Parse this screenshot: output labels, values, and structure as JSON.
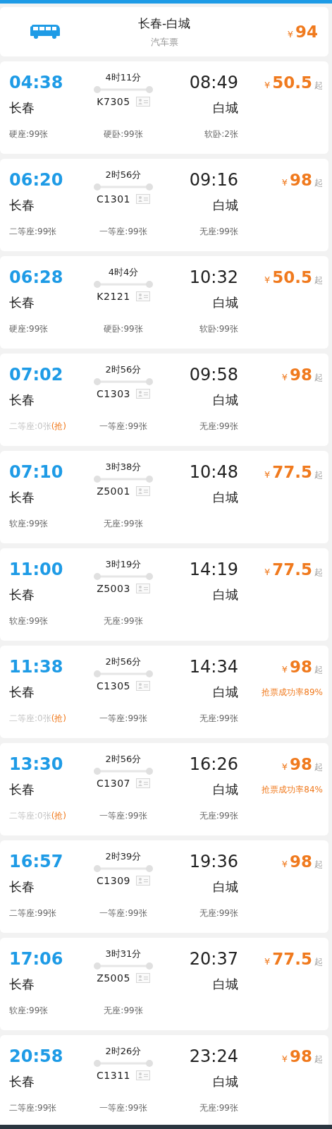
{
  "bus": {
    "title": "长春-白城",
    "subtitle": "汽车票",
    "currency": "¥",
    "price": "94"
  },
  "trains": [
    {
      "depart": "04:38",
      "from": "长春",
      "duration": "4时11分",
      "train": "K7305",
      "arrive": "08:49",
      "to": "白城",
      "currency": "¥",
      "price": "50.5",
      "suffix": "起",
      "seats": [
        {
          "label": "硬座:99张",
          "sold_out": false
        },
        {
          "label": "硬卧:99张",
          "sold_out": false
        },
        {
          "label": "软卧:2张",
          "sold_out": false
        }
      ]
    },
    {
      "depart": "06:20",
      "from": "长春",
      "duration": "2时56分",
      "train": "C1301",
      "arrive": "09:16",
      "to": "白城",
      "currency": "¥",
      "price": "98",
      "suffix": "起",
      "seats": [
        {
          "label": "二等座:99张",
          "sold_out": false
        },
        {
          "label": "一等座:99张",
          "sold_out": false
        },
        {
          "label": "无座:99张",
          "sold_out": false
        }
      ]
    },
    {
      "depart": "06:28",
      "from": "长春",
      "duration": "4时4分",
      "train": "K2121",
      "arrive": "10:32",
      "to": "白城",
      "currency": "¥",
      "price": "50.5",
      "suffix": "起",
      "seats": [
        {
          "label": "硬座:99张",
          "sold_out": false
        },
        {
          "label": "硬卧:99张",
          "sold_out": false
        },
        {
          "label": "软卧:99张",
          "sold_out": false
        }
      ]
    },
    {
      "depart": "07:02",
      "from": "长春",
      "duration": "2时56分",
      "train": "C1303",
      "arrive": "09:58",
      "to": "白城",
      "currency": "¥",
      "price": "98",
      "suffix": "起",
      "seats": [
        {
          "label": "二等座:0张",
          "sold_out": true,
          "grab": "(抢)"
        },
        {
          "label": "一等座:99张",
          "sold_out": false
        },
        {
          "label": "无座:99张",
          "sold_out": false
        }
      ]
    },
    {
      "depart": "07:10",
      "from": "长春",
      "duration": "3时38分",
      "train": "Z5001",
      "arrive": "10:48",
      "to": "白城",
      "currency": "¥",
      "price": "77.5",
      "suffix": "起",
      "seats": [
        {
          "label": "软座:99张",
          "sold_out": false
        },
        {
          "label": "无座:99张",
          "sold_out": false
        }
      ]
    },
    {
      "depart": "11:00",
      "from": "长春",
      "duration": "3时19分",
      "train": "Z5003",
      "arrive": "14:19",
      "to": "白城",
      "currency": "¥",
      "price": "77.5",
      "suffix": "起",
      "seats": [
        {
          "label": "软座:99张",
          "sold_out": false
        },
        {
          "label": "无座:99张",
          "sold_out": false
        }
      ]
    },
    {
      "depart": "11:38",
      "from": "长春",
      "duration": "2时56分",
      "train": "C1305",
      "arrive": "14:34",
      "to": "白城",
      "currency": "¥",
      "price": "98",
      "suffix": "起",
      "rate": "抢票成功率89%",
      "seats": [
        {
          "label": "二等座:0张",
          "sold_out": true,
          "grab": "(抢)"
        },
        {
          "label": "一等座:99张",
          "sold_out": false
        },
        {
          "label": "无座:99张",
          "sold_out": false
        }
      ]
    },
    {
      "depart": "13:30",
      "from": "长春",
      "duration": "2时56分",
      "train": "C1307",
      "arrive": "16:26",
      "to": "白城",
      "currency": "¥",
      "price": "98",
      "suffix": "起",
      "rate": "抢票成功率84%",
      "seats": [
        {
          "label": "二等座:0张",
          "sold_out": true,
          "grab": "(抢)"
        },
        {
          "label": "一等座:99张",
          "sold_out": false
        },
        {
          "label": "无座:99张",
          "sold_out": false
        }
      ]
    },
    {
      "depart": "16:57",
      "from": "长春",
      "duration": "2时39分",
      "train": "C1309",
      "arrive": "19:36",
      "to": "白城",
      "currency": "¥",
      "price": "98",
      "suffix": "起",
      "seats": [
        {
          "label": "二等座:99张",
          "sold_out": false
        },
        {
          "label": "一等座:99张",
          "sold_out": false
        },
        {
          "label": "无座:99张",
          "sold_out": false
        }
      ]
    },
    {
      "depart": "17:06",
      "from": "长春",
      "duration": "3时31分",
      "train": "Z5005",
      "arrive": "20:37",
      "to": "白城",
      "currency": "¥",
      "price": "77.5",
      "suffix": "起",
      "seats": [
        {
          "label": "软座:99张",
          "sold_out": false
        },
        {
          "label": "无座:99张",
          "sold_out": false
        }
      ]
    },
    {
      "depart": "20:58",
      "from": "长春",
      "duration": "2时26分",
      "train": "C1311",
      "arrive": "23:24",
      "to": "白城",
      "currency": "¥",
      "price": "98",
      "suffix": "起",
      "seats": [
        {
          "label": "二等座:99张",
          "sold_out": false
        },
        {
          "label": "一等座:99张",
          "sold_out": false
        },
        {
          "label": "无座:99张",
          "sold_out": false
        }
      ]
    }
  ]
}
